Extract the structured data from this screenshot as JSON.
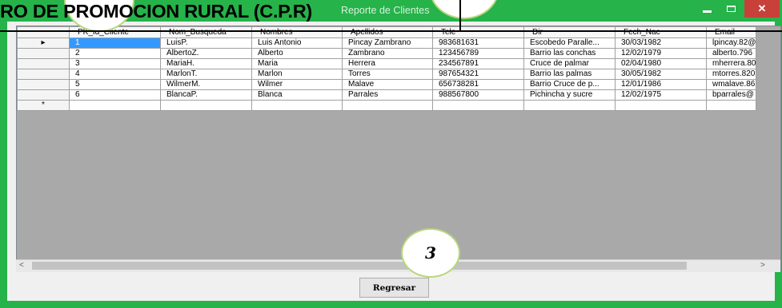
{
  "window": {
    "title": "Reporte de Clientes",
    "controls": [
      "minimize",
      "maximize",
      "close"
    ],
    "close_glyph": "✕",
    "frame_color": "#25b34a",
    "close_color": "#c7413a"
  },
  "overlay": {
    "heading": "RO DE PROMOCION RURAL (C.P.R)",
    "callout_3": "3"
  },
  "grid": {
    "columns": [
      "PK_Id_Cliente",
      "Nom_Busqueda",
      "Nombres",
      "Apellidos",
      "Tele",
      "Dir",
      "Fech_Nac",
      "Email"
    ],
    "rows": [
      [
        "1",
        "LuisP.",
        "Luis Antonio",
        "Pincay Zambrano",
        "983681631",
        "Escobedo Paralle...",
        "30/03/1982",
        "lpincay.82@"
      ],
      [
        "2",
        "AlbertoZ.",
        "Alberto",
        "Zambrano",
        "123456789",
        "Barrio las conchas",
        "12/02/1979",
        "alberto.796"
      ],
      [
        "3",
        "MariaH.",
        "Maria",
        "Herrera",
        "234567891",
        "Cruce de palmar",
        "02/04/1980",
        "mherrera.80"
      ],
      [
        "4",
        "MarlonT.",
        "Marlon",
        "Torres",
        "987654321",
        "Barrio las palmas",
        "30/05/1982",
        "mtorres.820"
      ],
      [
        "5",
        "WilmerM.",
        "Wilmer",
        "Malave",
        "656738281",
        "Barrio Cruce de p...",
        "12/01/1986",
        "wmalave.86"
      ],
      [
        "6",
        "BlancaP.",
        "Blanca",
        "Parrales",
        "988567800",
        "Pichincha y sucre",
        "12/02/1975",
        "bparrales@"
      ]
    ],
    "current_row_marker": "▸",
    "new_row_marker": "*",
    "selected_color": "#3399ff"
  },
  "scrollbar": {
    "left_arrow": "<",
    "right_arrow": ">"
  },
  "buttons": {
    "back_label": "Regresar"
  }
}
